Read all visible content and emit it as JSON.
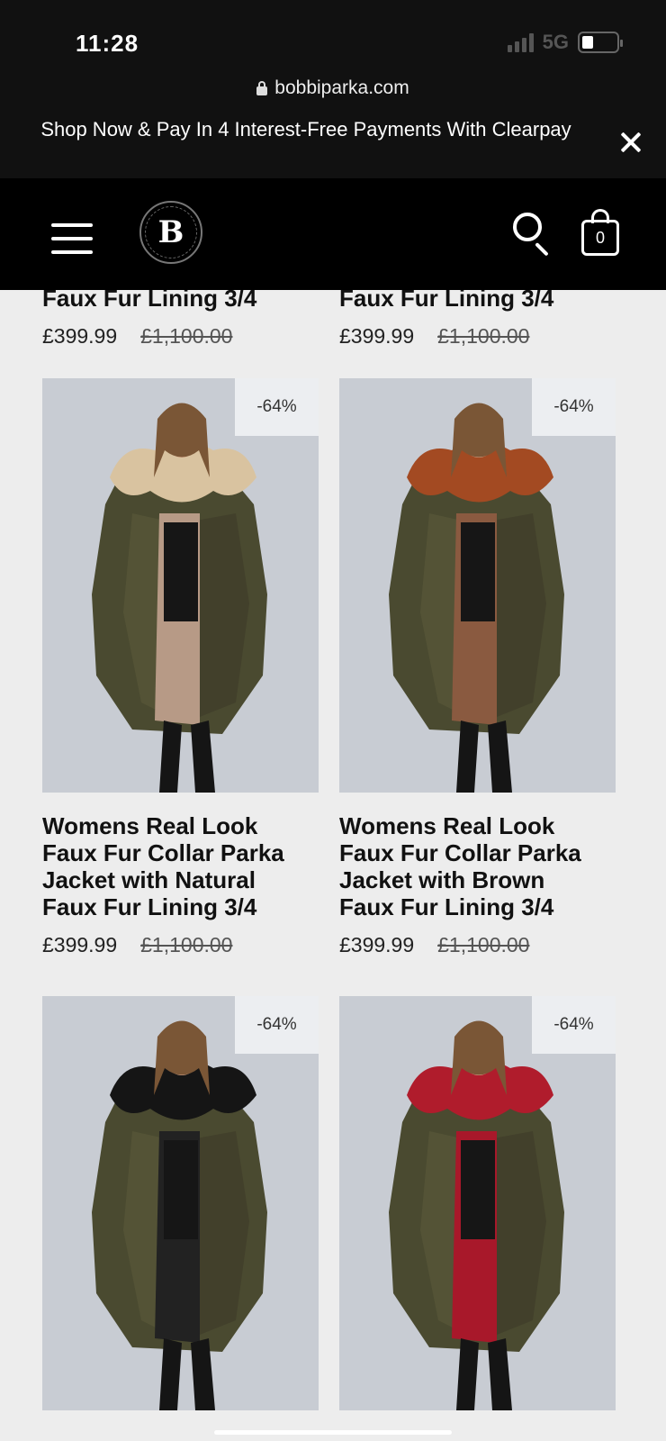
{
  "status_bar": {
    "time": "11:28",
    "network": "5G"
  },
  "browser": {
    "url": "bobbiparka.com"
  },
  "promo": {
    "text": "Shop Now & Pay In 4 Interest-Free Payments With Clearpay"
  },
  "header": {
    "logo_letter": "B",
    "cart_count": "0"
  },
  "products": [
    {
      "title_lines": [
        "Faux Fur Lining 3/4"
      ],
      "price": "£399.99",
      "compare_price": "£1,100.00"
    },
    {
      "title_lines": [
        "Faux Fur Lining 3/4"
      ],
      "price": "£399.99",
      "compare_price": "£1,100.00"
    },
    {
      "badge": "-64%",
      "fur_color": "#d9c3a0",
      "lining_color": "#b79a86",
      "title_lines": [
        "Womens Real Look",
        "Faux Fur Collar Parka",
        "Jacket with Natural",
        "Faux Fur Lining 3/4"
      ],
      "price": "£399.99",
      "compare_price": "£1,100.00"
    },
    {
      "badge": "-64%",
      "fur_color": "#a34a22",
      "lining_color": "#8a5a40",
      "title_lines": [
        "Womens Real Look",
        "Faux Fur Collar Parka",
        "Jacket with Brown",
        "Faux Fur Lining 3/4"
      ],
      "price": "£399.99",
      "compare_price": "£1,100.00"
    },
    {
      "badge": "-64%",
      "fur_color": "#151515",
      "lining_color": "#222222"
    },
    {
      "badge": "-64%",
      "fur_color": "#b01c2c",
      "lining_color": "#a8182a"
    }
  ]
}
